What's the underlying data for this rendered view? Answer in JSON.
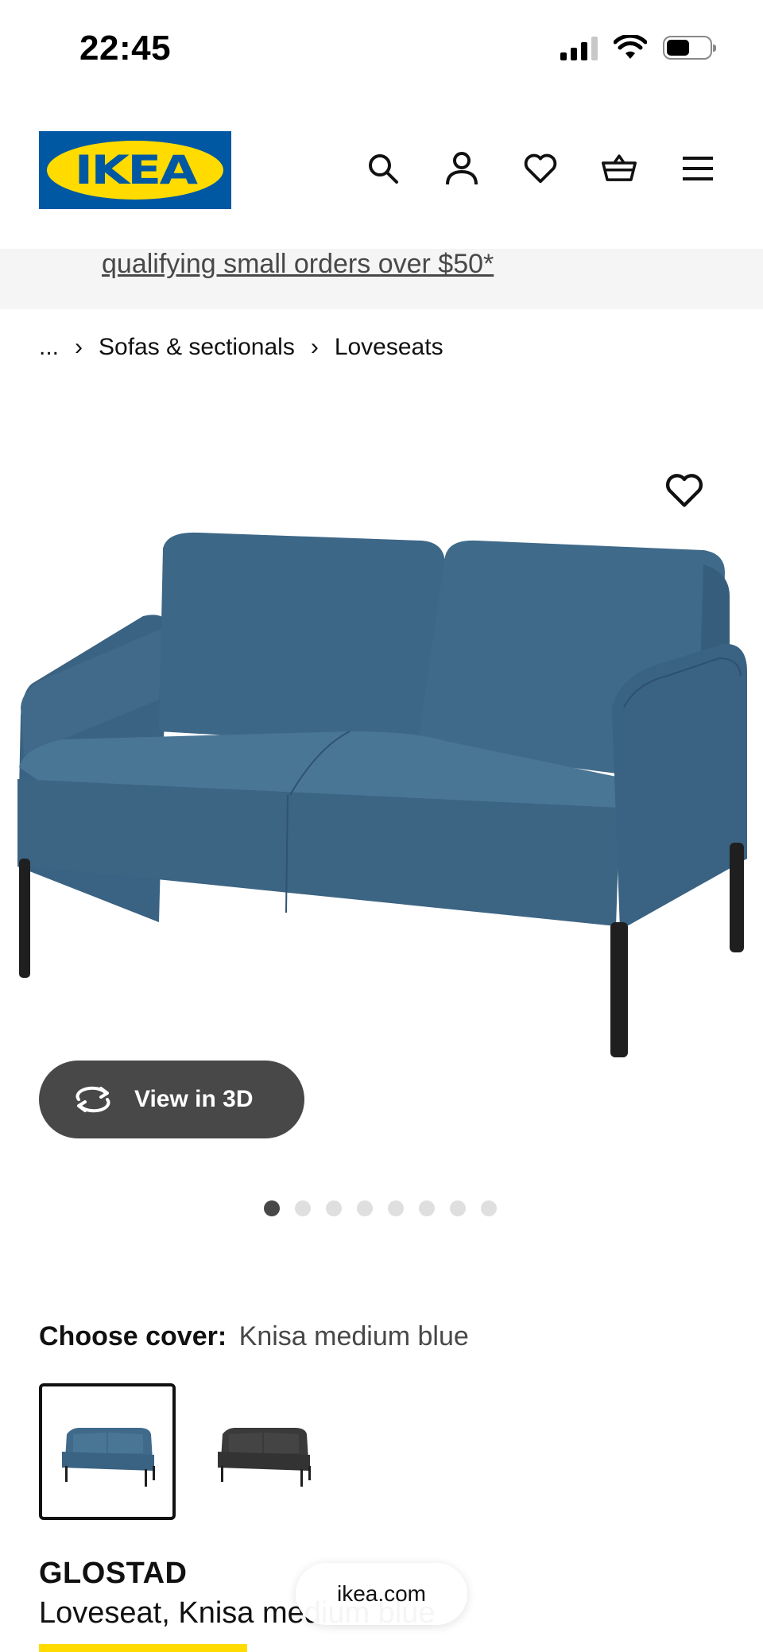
{
  "status_bar": {
    "time": "22:45",
    "icons": [
      "cellular-signal-icon",
      "wifi-icon",
      "battery-icon"
    ]
  },
  "header": {
    "logo_text": "IKEA",
    "icons": [
      "search-icon",
      "account-icon",
      "favorites-icon",
      "cart-icon",
      "menu-icon"
    ]
  },
  "promo": {
    "link_text": "qualifying small orders over $50*"
  },
  "breadcrumb": {
    "items": [
      "...",
      "Sofas & sectionals",
      "Loveseats"
    ]
  },
  "gallery": {
    "view3d_label": "View in 3D",
    "dot_count": 8,
    "active_index": 0
  },
  "cover": {
    "label": "Choose cover:",
    "value": "Knisa medium blue",
    "options": [
      "Knisa medium blue",
      "Knisa dark gray"
    ],
    "selected_index": 0
  },
  "product": {
    "name": "GLOSTAD",
    "description": "Loveseat, Knisa medium blue"
  },
  "browser": {
    "url": "ikea.com"
  },
  "colors": {
    "brand_blue": "#0058a3",
    "brand_yellow": "#ffdb00",
    "sofa_blue": "#3f6a8a",
    "sofa_gray": "#3a3a3a"
  }
}
